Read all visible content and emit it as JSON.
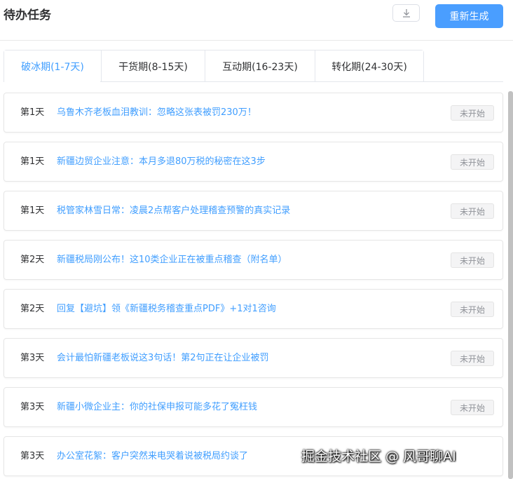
{
  "header": {
    "title": "待办任务",
    "download_icon": "download-icon",
    "regenerate_label": "重新生成"
  },
  "tabs": [
    {
      "label": "破冰期(1-7天)",
      "active": true
    },
    {
      "label": "干货期(8-15天)",
      "active": false
    },
    {
      "label": "互动期(16-23天)",
      "active": false
    },
    {
      "label": "转化期(24-30天)",
      "active": false
    }
  ],
  "tasks": [
    {
      "day": "第1天",
      "title": "乌鲁木齐老板血泪教训：忽略这张表被罚230万！",
      "status": "未开始"
    },
    {
      "day": "第1天",
      "title": "新疆边贸企业注意：本月多退80万税的秘密在这3步",
      "status": "未开始"
    },
    {
      "day": "第1天",
      "title": "税管家林雪日常：凌晨2点帮客户处理稽查预警的真实记录",
      "status": "未开始"
    },
    {
      "day": "第2天",
      "title": "新疆税局刚公布！这10类企业正在被重点稽查（附名单）",
      "status": "未开始"
    },
    {
      "day": "第2天",
      "title": "回复【避坑】领《新疆税务稽查重点PDF》+1对1咨询",
      "status": "未开始"
    },
    {
      "day": "第3天",
      "title": "会计最怕新疆老板说这3句话！第2句正在让企业被罚",
      "status": "未开始"
    },
    {
      "day": "第3天",
      "title": "新疆小微企业主：你的社保申报可能多花了冤枉钱",
      "status": "未开始"
    },
    {
      "day": "第3天",
      "title": "办公室花絮：客户突然来电哭着说被税局约谈了",
      "status": ""
    }
  ],
  "watermark": "掘金技术社区 @ 风哥聊AI",
  "colors": {
    "accent": "#409eff",
    "button": "#4a9eff",
    "status_bg": "#f4f4f5"
  }
}
